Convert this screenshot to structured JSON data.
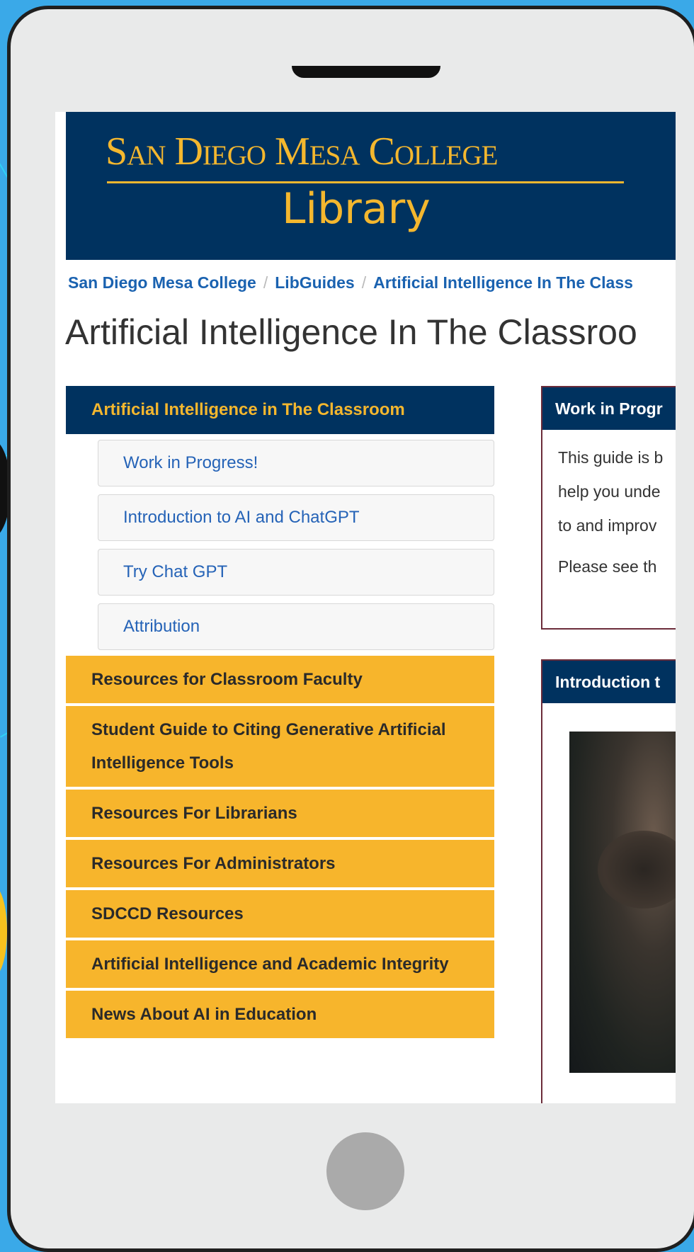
{
  "banner": {
    "college": "San Diego Mesa College",
    "library": "Library"
  },
  "breadcrumb": [
    "San Diego Mesa College",
    "LibGuides",
    "Artificial Intelligence In The Class"
  ],
  "page_title": "Artificial Intelligence In The Classroo",
  "nav": {
    "active": "Artificial Intelligence in The Classroom",
    "subitems": [
      "Work in Progress!",
      "Introduction to AI and ChatGPT",
      "Try Chat GPT",
      "Attribution"
    ],
    "items": [
      "Resources for Classroom Faculty",
      "Student Guide to Citing Generative Artificial Intelligence Tools",
      "Resources For Librarians",
      "Resources For Administrators",
      "SDCCD Resources",
      "Artificial Intelligence and Academic Integrity",
      "News About AI in Education"
    ]
  },
  "panel1": {
    "title": "Work in Progr",
    "lines": [
      "This guide is b",
      "help you unde",
      "to and improv",
      "Please see th"
    ]
  },
  "panel2": {
    "title": "Introduction t"
  },
  "colors": {
    "navy": "#00325f",
    "gold": "#f4b72e",
    "nav_gold": "#f7b52c",
    "link": "#1a62b0"
  }
}
